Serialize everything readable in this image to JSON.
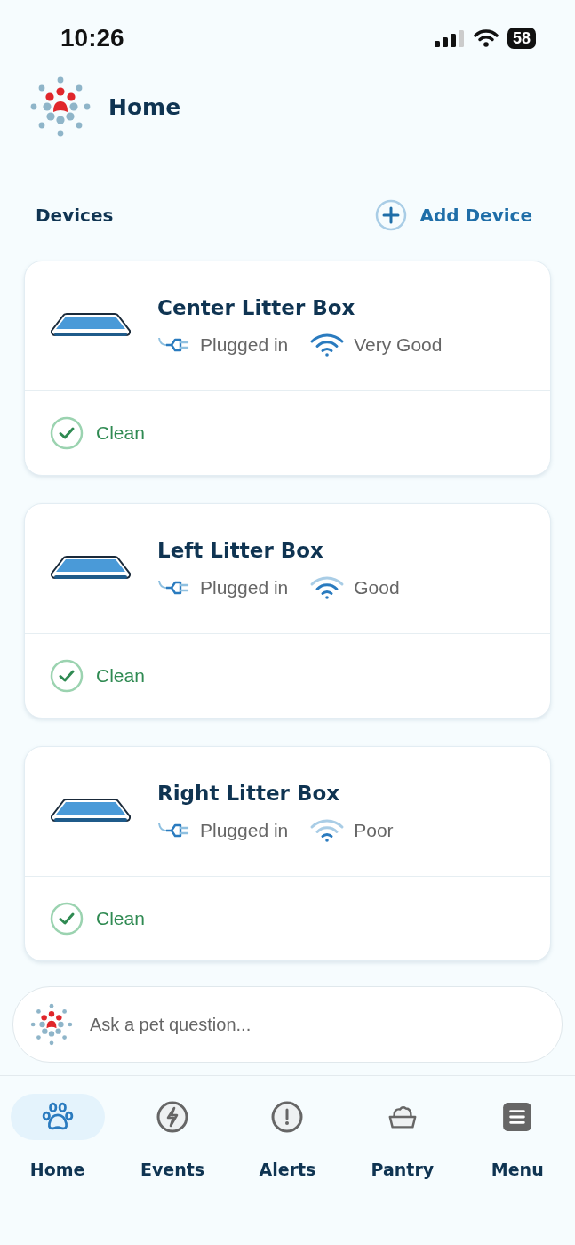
{
  "status_bar": {
    "time": "10:26",
    "battery": "58"
  },
  "header": {
    "title": "Home"
  },
  "devices_section": {
    "title": "Devices",
    "add_button": "Add Device"
  },
  "devices": [
    {
      "name": "Center Litter Box",
      "power": "Plugged in",
      "kind": "strong",
      "wifi": "Very Good",
      "status": "Clean"
    },
    {
      "name": "Left Litter Box",
      "power": "Plugged in",
      "kind": "fair",
      "wifi": "Good",
      "status": "Clean"
    },
    {
      "name": "Right Litter Box",
      "power": "Plugged in",
      "kind": "weak",
      "wifi": "Poor",
      "status": "Clean"
    }
  ],
  "ask": {
    "placeholder": "Ask a pet question..."
  },
  "nav": [
    {
      "label": "Home",
      "kind": "paw",
      "selected": true
    },
    {
      "label": "Events",
      "kind": "bolt",
      "selected": false
    },
    {
      "label": "Alerts",
      "kind": "alert",
      "selected": false
    },
    {
      "label": "Pantry",
      "kind": "bowl",
      "selected": false
    },
    {
      "label": "Menu",
      "kind": "menu",
      "selected": false
    }
  ]
}
